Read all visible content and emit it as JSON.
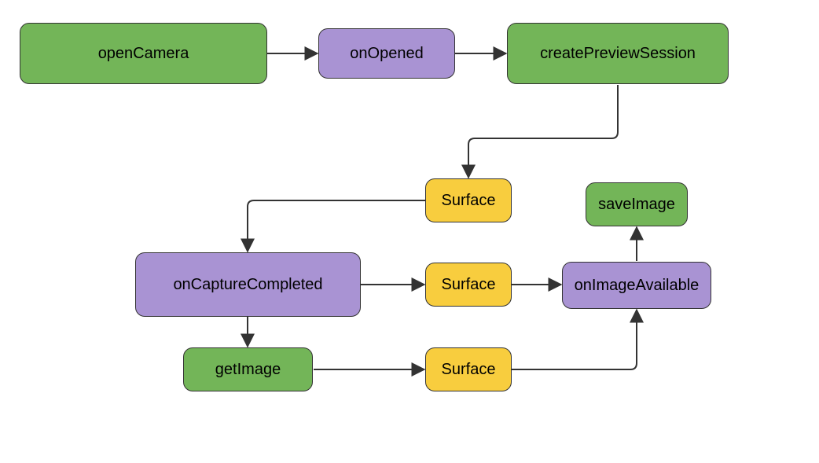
{
  "colors": {
    "green": "#73b558",
    "purple": "#a993d3",
    "yellow": "#f8cd3e",
    "edge": "#333333"
  },
  "nodes": {
    "openCamera": {
      "label": "openCamera",
      "color": "green"
    },
    "onOpened": {
      "label": "onOpened",
      "color": "purple"
    },
    "createPreviewSession": {
      "label": "createPreviewSession",
      "color": "green"
    },
    "surface1": {
      "label": "Surface",
      "color": "yellow"
    },
    "onCaptureCompleted": {
      "label": "onCaptureCompleted",
      "color": "purple"
    },
    "surface2": {
      "label": "Surface",
      "color": "yellow"
    },
    "getImage": {
      "label": "getImage",
      "color": "green"
    },
    "surface3": {
      "label": "Surface",
      "color": "yellow"
    },
    "onImageAvailable": {
      "label": "onImageAvailable",
      "color": "purple"
    },
    "saveImage": {
      "label": "saveImage",
      "color": "green"
    }
  },
  "edges": [
    {
      "from": "openCamera",
      "to": "onOpened"
    },
    {
      "from": "onOpened",
      "to": "createPreviewSession"
    },
    {
      "from": "createPreviewSession",
      "to": "surface1"
    },
    {
      "from": "surface1",
      "to": "onCaptureCompleted"
    },
    {
      "from": "onCaptureCompleted",
      "to": "surface2"
    },
    {
      "from": "onCaptureCompleted",
      "to": "getImage"
    },
    {
      "from": "getImage",
      "to": "surface3"
    },
    {
      "from": "surface2",
      "to": "onImageAvailable"
    },
    {
      "from": "surface3",
      "to": "onImageAvailable"
    },
    {
      "from": "onImageAvailable",
      "to": "saveImage"
    }
  ]
}
